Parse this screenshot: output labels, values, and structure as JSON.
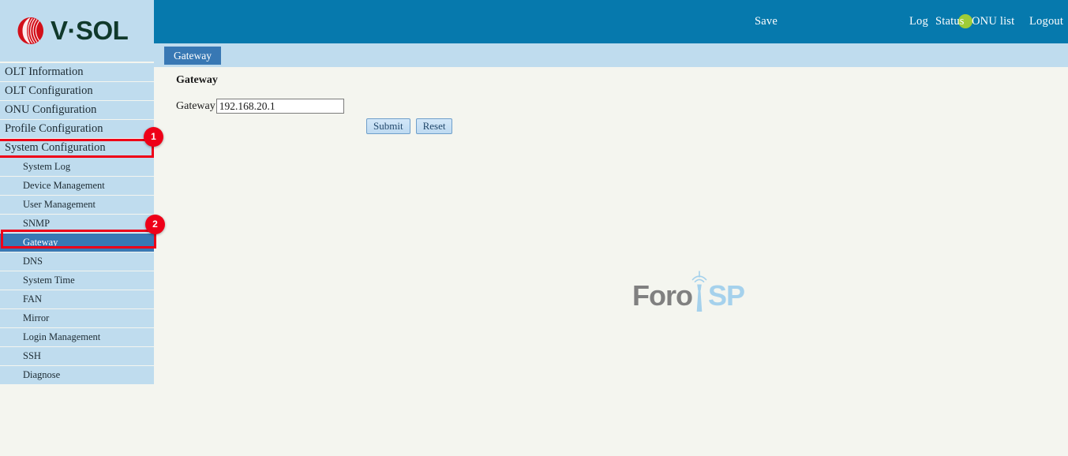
{
  "brand": {
    "name": "V·SOL",
    "logo_icon": "vsol-swirl-icon",
    "logo_color": "#d3101a",
    "text_color": "#10392b"
  },
  "header": {
    "background": "#0679ad",
    "save_label": "Save",
    "status_indicator": {
      "icon": "status-dot-icon",
      "color": "#9fcc37"
    },
    "links": [
      {
        "label": "Log"
      },
      {
        "label": "Status"
      },
      {
        "label": "ONU list"
      },
      {
        "label": "Logout"
      }
    ]
  },
  "tabs": {
    "band_color": "#bfdcee",
    "active_color": "#3878b4",
    "items": [
      {
        "label": "Gateway",
        "active": true
      }
    ]
  },
  "sidebar": {
    "background": "#bfdcee",
    "selected_color": "#3878b4",
    "items": [
      {
        "label": "OLT Information",
        "level": 1,
        "selected": false
      },
      {
        "label": "OLT Configuration",
        "level": 1,
        "selected": false
      },
      {
        "label": "ONU Configuration",
        "level": 1,
        "selected": false
      },
      {
        "label": "Profile Configuration",
        "level": 1,
        "selected": false
      },
      {
        "label": "System Configuration",
        "level": 1,
        "selected": false
      },
      {
        "label": "System Log",
        "level": 2,
        "selected": false
      },
      {
        "label": "Device Management",
        "level": 2,
        "selected": false
      },
      {
        "label": "User Management",
        "level": 2,
        "selected": false
      },
      {
        "label": "SNMP",
        "level": 2,
        "selected": false
      },
      {
        "label": "Gateway",
        "level": 2,
        "selected": true
      },
      {
        "label": "DNS",
        "level": 2,
        "selected": false
      },
      {
        "label": "System Time",
        "level": 2,
        "selected": false
      },
      {
        "label": "FAN",
        "level": 2,
        "selected": false
      },
      {
        "label": "Mirror",
        "level": 2,
        "selected": false
      },
      {
        "label": "Login Management",
        "level": 2,
        "selected": false
      },
      {
        "label": "SSH",
        "level": 2,
        "selected": false
      },
      {
        "label": "Diagnose",
        "level": 2,
        "selected": false
      }
    ]
  },
  "content": {
    "title": "Gateway",
    "form": {
      "gateway_label": "Gateway",
      "gateway_value": "192.168.20.1",
      "gateway_placeholder": ""
    },
    "buttons": {
      "submit_label": "Submit",
      "reset_label": "Reset"
    }
  },
  "watermark": {
    "text_left": "Foro",
    "text_right": "SP",
    "tower_icon": "antenna-tower-icon",
    "left_color": "#808080",
    "right_color": "#a5d1ec"
  },
  "annotations": [
    {
      "number": "1",
      "target": "System Configuration",
      "color": "#ee0018"
    },
    {
      "number": "2",
      "target": "Gateway",
      "color": "#ee0018"
    }
  ]
}
